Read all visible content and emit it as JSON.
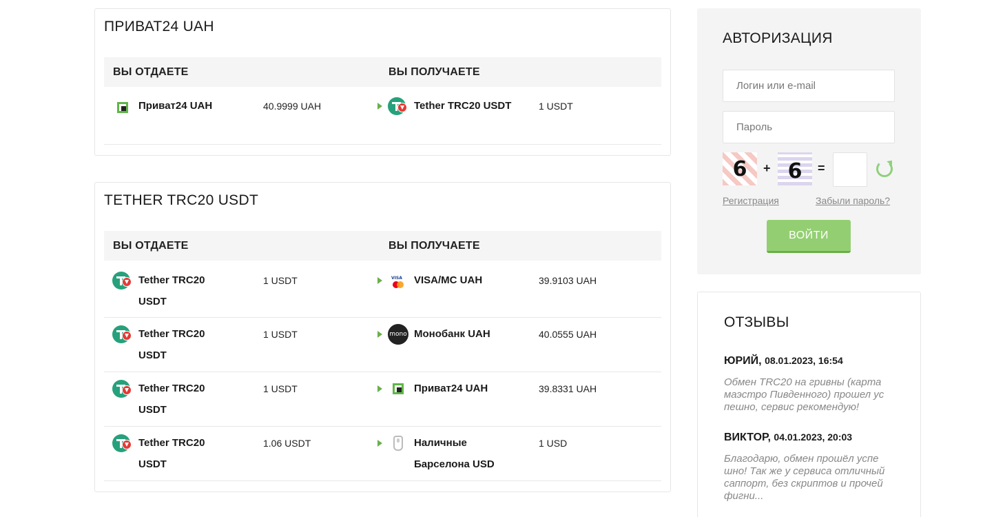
{
  "panel1": {
    "title": "ПРИВАТ24 UAH",
    "col_give": "ВЫ ОТДАЕТЕ",
    "col_get": "ВЫ ПОЛУЧАЕТЕ",
    "rows": [
      {
        "give_icon": "privat24-icon",
        "give_name": "Приват24 UAH",
        "give_amount": "40.9999 UAH",
        "get_icon": "tether-trc20-icon",
        "get_name": "Tether TRC20 USDT",
        "get_amount": "1 USDT"
      }
    ]
  },
  "panel2": {
    "title": "TETHER TRC20 USDT",
    "col_give": "ВЫ ОТДАЕТЕ",
    "col_get": "ВЫ ПОЛУЧАЕТЕ",
    "rows": [
      {
        "give_icon": "tether-trc20-icon",
        "give_name": "Tether TRC20 USDT",
        "give_amount": "1 USDT",
        "get_icon": "visa-mastercard-icon",
        "get_name": "VISA/MC UAH",
        "get_amount": "39.9103 UAH"
      },
      {
        "give_icon": "tether-trc20-icon",
        "give_name": "Tether TRC20 USDT",
        "give_amount": "1 USDT",
        "get_icon": "monobank-icon",
        "get_name": "Монобанк UAH",
        "get_amount": "40.0555 UAH"
      },
      {
        "give_icon": "tether-trc20-icon",
        "give_name": "Tether TRC20 USDT",
        "give_amount": "1 USDT",
        "get_icon": "privat24-icon",
        "get_name": "Приват24 UAH",
        "get_amount": "39.8331 UAH"
      },
      {
        "give_icon": "tether-trc20-icon",
        "give_name": "Tether TRC20 USDT",
        "give_amount": "1.06 USDT",
        "get_icon": "cash-icon",
        "get_name": "Наличные Барселона USD",
        "get_amount": "1 USD"
      }
    ]
  },
  "auth": {
    "title": "АВТОРИЗАЦИЯ",
    "login_placeholder": "Логин или e-mail",
    "password_placeholder": "Пароль",
    "captcha": {
      "a": "6",
      "plus": "+",
      "b": "6",
      "equals": "="
    },
    "register_link": "Регистрация",
    "forgot_link": "Забыли пароль?",
    "login_button": "ВОЙТИ"
  },
  "reviews": {
    "title": "ОТЗЫВЫ",
    "items": [
      {
        "author": "ЮРИЙ,",
        "date": "08.01.2023, 16:54",
        "text": "Обмен TRC20 на гривны (карта маэстро Пивденного) прошел ус пешно, сервис рекомендую!"
      },
      {
        "author": "ВИКТОР,",
        "date": "04.01.2023, 20:03",
        "text": "Благодарю, обмен прошёл успе шно! Так же у сервиса отличный саппорт, без скриптов и прочей фигни..."
      }
    ]
  },
  "colors": {
    "accent_green": "#93cf72",
    "tether": "#26a17b",
    "tron": "#e53935"
  }
}
